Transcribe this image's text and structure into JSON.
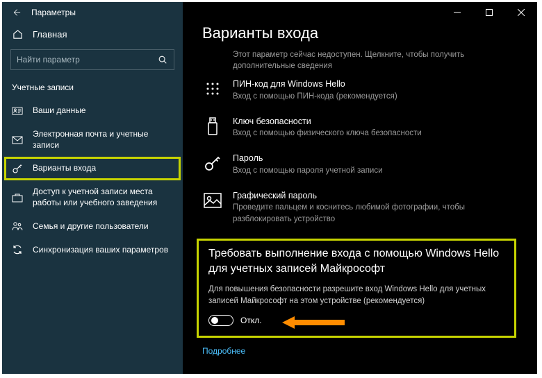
{
  "titlebar": {
    "title": "Параметры"
  },
  "sidebar": {
    "home": "Главная",
    "search_placeholder": "Найти параметр",
    "section": "Учетные записи",
    "items": [
      {
        "label": "Ваши данные"
      },
      {
        "label": "Электронная почта и учетные записи"
      },
      {
        "label": "Варианты входа"
      },
      {
        "label": "Доступ к учетной записи места работы или учебного заведения"
      },
      {
        "label": "Семья и другие пользователи"
      },
      {
        "label": "Синхронизация ваших параметров"
      }
    ]
  },
  "content": {
    "title": "Варианты входа",
    "truncated_desc": "Этот параметр сейчас недоступен. Щелкните, чтобы получить дополнительные сведения",
    "options": [
      {
        "title": "ПИН-код для Windows Hello",
        "desc": "Вход с помощью ПИН-кода (рекомендуется)"
      },
      {
        "title": "Ключ безопасности",
        "desc": "Вход с помощью физического ключа безопасности"
      },
      {
        "title": "Пароль",
        "desc": "Вход с помощью пароля учетной записи"
      },
      {
        "title": "Графический пароль",
        "desc": "Проведите пальцем и коснитесь любимой фотографии, чтобы разблокировать устройство"
      }
    ],
    "hello": {
      "title": "Требовать выполнение входа с помощью Windows Hello для учетных записей Майкрософт",
      "desc": "Для повышения безопасности разрешите вход Windows Hello для учетных записей Майкрософт на этом устройстве (рекомендуется)",
      "toggle_label": "Откл.",
      "toggle_on": false
    },
    "more_link": "Подробнее"
  }
}
